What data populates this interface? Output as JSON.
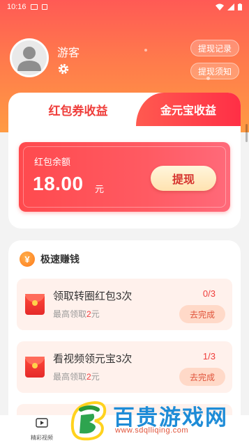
{
  "status_bar": {
    "time": "10:16"
  },
  "profile": {
    "username": "游客"
  },
  "header_buttons": {
    "record": "提现记录",
    "notice": "提现须知"
  },
  "tabs": {
    "active": "红包券收益",
    "inactive": "金元宝收益"
  },
  "balance": {
    "label": "红包余额",
    "amount": "18.00",
    "unit": "元",
    "withdraw": "提现"
  },
  "tasks": {
    "title": "极速赚钱",
    "icon": "¥",
    "items": [
      {
        "title": "领取转圈红包3次",
        "sub_prefix": "最高领取",
        "sub_amount": "2",
        "sub_suffix": "元",
        "progress": "0/3",
        "button": "去完成"
      },
      {
        "title": "看视频领元宝3次",
        "sub_prefix": "最高领取",
        "sub_amount": "2",
        "sub_suffix": "元",
        "progress": "1/3",
        "button": "去完成"
      }
    ]
  },
  "bottom_nav": {
    "video_label": "精彩视频"
  },
  "watermark": {
    "text": "百贵游戏网",
    "url": "www.sdqlliqing.com"
  },
  "colors": {
    "accent": "#ef3d3a",
    "header_top": "#ff5a55",
    "header_bottom": "#ff9b43",
    "watermark_blue": "#1e8cd7"
  }
}
